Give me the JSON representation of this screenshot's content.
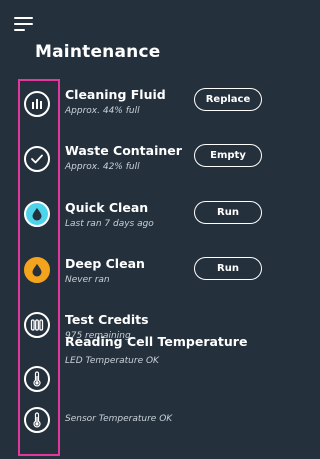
{
  "header": {
    "title": "Maintenance",
    "menu_icon": "hamburger-menu-icon"
  },
  "colors": {
    "background": "#24303c",
    "highlight": "#e2379c",
    "accent_teal": "#4dd4ea",
    "accent_orange": "#f3a41c"
  },
  "items": [
    {
      "title": "Cleaning Fluid",
      "subtitle": "Approx. 44% full",
      "button": "Replace",
      "icon": "bars-icon"
    },
    {
      "title": "Waste Container",
      "subtitle": "Approx. 42% full",
      "button": "Empty",
      "icon": "check-circle-icon"
    },
    {
      "title": "Quick Clean",
      "subtitle": "Last ran 7 days ago",
      "button": "Run",
      "icon": "droplet-icon"
    },
    {
      "title": "Deep Clean",
      "subtitle": "Never ran",
      "button": "Run",
      "icon": "droplet-icon"
    },
    {
      "title": "Test Credits",
      "subtitle": "975 remaining",
      "icon": "test-tubes-icon"
    }
  ],
  "temperature": {
    "title": "Reading Cell Temperature",
    "led_status": "LED Temperature OK",
    "sensor_status": "Sensor Temperature OK",
    "icon": "thermometer-icon"
  }
}
